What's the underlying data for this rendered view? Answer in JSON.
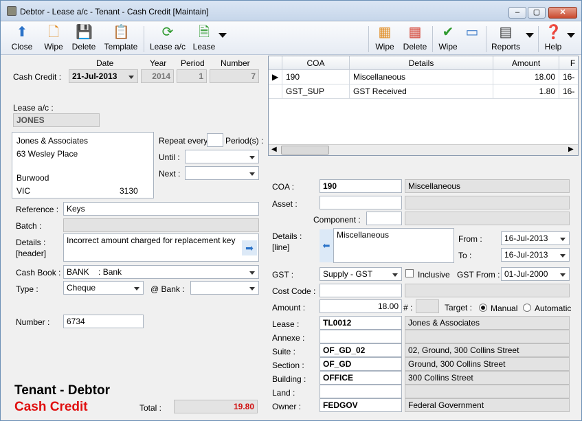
{
  "window": {
    "title": "Debtor - Lease a/c - Tenant - Cash Credit [Maintain]"
  },
  "toolbar": {
    "close": "Close",
    "wipe": "Wipe",
    "delete": "Delete",
    "template": "Template",
    "lease_ac": "Lease a/c",
    "lease": "Lease",
    "wipe2": "Wipe",
    "delete2": "Delete",
    "wipe3": "Wipe",
    "reports": "Reports",
    "help": "Help"
  },
  "header": {
    "col_date": "Date",
    "col_year": "Year",
    "col_period": "Period",
    "col_number": "Number",
    "cash_credit_label": "Cash Credit :",
    "date": "21-Jul-2013",
    "year": "2014",
    "period": "1",
    "number": "7"
  },
  "lease_ac": {
    "label": "Lease a/c :",
    "value": "JONES",
    "address": [
      "Jones & Associates",
      "63 Wesley Place",
      "",
      "Burwood"
    ],
    "state": "VIC",
    "postcode": "3130"
  },
  "repeat": {
    "label": "Repeat every",
    "periods": "Period(s) :",
    "until": "Until :",
    "next": "Next :"
  },
  "form": {
    "reference_label": "Reference :",
    "reference": "Keys",
    "batch_label": "Batch :",
    "details_label": "Details :",
    "details_sub": "[header]",
    "details": "Incorrect amount charged for replacement key",
    "cashbook_label": "Cash Book :",
    "cashbook_code": "BANK",
    "cashbook_name": ": Bank",
    "type_label": "Type :",
    "type": "Cheque",
    "bank_label": "@ Bank :",
    "number_label": "Number :",
    "number": "6734"
  },
  "footer": {
    "title1": "Tenant - Debtor",
    "title2": "Cash Credit",
    "total_label": "Total :",
    "total": "19.80"
  },
  "grid": {
    "headers": [
      "COA",
      "Details",
      "Amount",
      "F"
    ],
    "rows": [
      {
        "coa": "190",
        "details": "Miscellaneous",
        "amount": "18.00",
        "f": "16-"
      },
      {
        "coa": "GST_SUP",
        "details": "GST Received",
        "amount": "1.80",
        "f": "16-"
      }
    ]
  },
  "line": {
    "coa_label": "COA :",
    "coa": "190",
    "coa_name": "Miscellaneous",
    "asset_label": "Asset :",
    "component_label": "Component :",
    "details_label": "Details :",
    "details_sub": "[line]",
    "details": "Miscellaneous",
    "from_label": "From :",
    "from": "16-Jul-2013",
    "to_label": "To :",
    "to": "16-Jul-2013",
    "gst_label": "GST :",
    "gst": "Supply - GST",
    "inclusive": "Inclusive",
    "gst_from_label": "GST From :",
    "gst_from": "01-Jul-2000",
    "costcode_label": "Cost Code :",
    "amount_label": "Amount :",
    "amount": "18.00",
    "hash_label": "# :",
    "target_label": "Target :",
    "manual": "Manual",
    "automatic": "Automatic",
    "lease_label": "Lease :",
    "lease": "TL0012",
    "lease_name": "Jones & Associates",
    "annexe_label": "Annexe :",
    "suite_label": "Suite :",
    "suite": "OF_GD_02",
    "suite_name": "02, Ground, 300 Collins Street",
    "section_label": "Section :",
    "section": "OF_GD",
    "section_name": "Ground, 300 Collins Street",
    "building_label": "Building :",
    "building": "OFFICE",
    "building_name": "300 Collins Street",
    "land_label": "Land :",
    "owner_label": "Owner :",
    "owner": "FEDGOV",
    "owner_name": "Federal Government"
  }
}
